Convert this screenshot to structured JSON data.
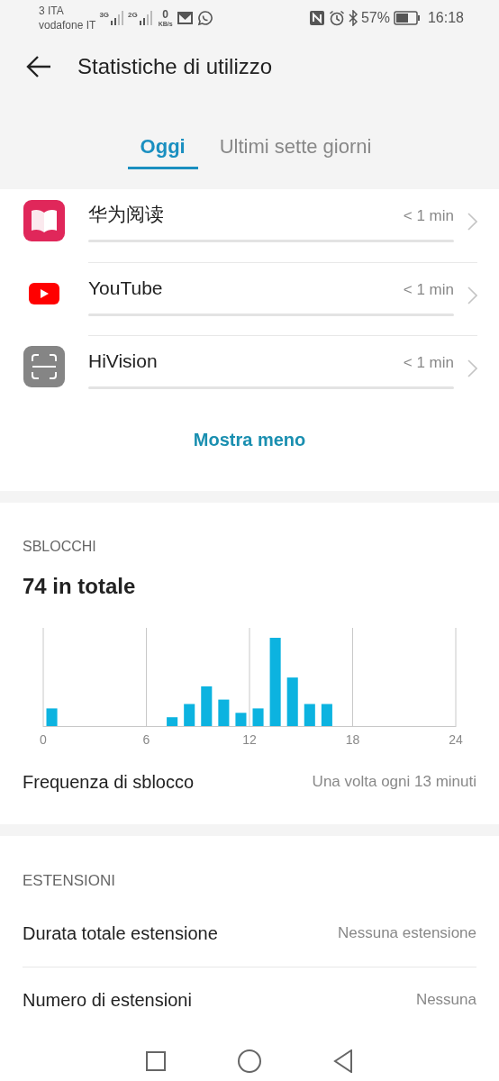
{
  "status_bar": {
    "carrier_1": "3 ITA",
    "carrier_2": "vodafone IT",
    "network_1": "3G",
    "network_2": "2G",
    "speed": "0",
    "speed_unit": "KB/s",
    "battery": "57%",
    "time": "16:18"
  },
  "header": {
    "title": "Statistiche di utilizzo"
  },
  "tabs": [
    {
      "label": "Oggi",
      "selected": true
    },
    {
      "label": "Ultimi sette giorni",
      "selected": false
    }
  ],
  "apps": [
    {
      "name": "华为阅读",
      "time": "< 1 min"
    },
    {
      "name": "YouTube",
      "time": "< 1 min"
    },
    {
      "name": "HiVision",
      "time": "< 1 min"
    }
  ],
  "show_less": "Mostra meno",
  "unlocks": {
    "heading": "SBLOCCHI",
    "total": "74 in totale",
    "axis_labels": [
      "0",
      "6",
      "12",
      "18",
      "24"
    ],
    "frequency_label": "Frequenza di sblocco",
    "frequency_value": "Una volta ogni 13 minuti"
  },
  "extensions": {
    "heading": "ESTENSIONI",
    "rows": [
      {
        "label": "Durata totale estensione",
        "value": "Nessuna estensione"
      },
      {
        "label": "Numero di estensioni",
        "value": "Nessuna"
      }
    ]
  }
}
